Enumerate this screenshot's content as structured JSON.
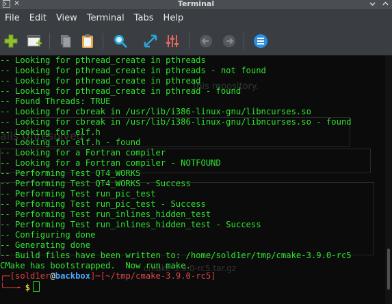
{
  "window": {
    "title": "Terminal",
    "left_icons": [
      "terminal-icon",
      "close-small-icon"
    ],
    "right_icons": [
      "minimize-icon",
      "maximize-icon"
    ]
  },
  "menu": [
    "File",
    "Edit",
    "View",
    "Terminal",
    "Tabs",
    "Help"
  ],
  "toolbar": {
    "icons": [
      "new-tab-icon",
      "new-window-icon",
      "copy-icon",
      "paste-icon",
      "search-icon",
      "fullscreen-icon",
      "settings-sliders-icon",
      "back-icon",
      "forward-icon",
      "menu-icon"
    ]
  },
  "terminal": {
    "lines": [
      "-- Looking for pthread_create in pthreads",
      "-- Looking for pthread_create in pthreads - not found",
      "-- Looking for pthread_create in pthread",
      "-- Looking for pthread_create in pthread - found",
      "-- Found Threads: TRUE",
      "-- Looking for cbreak in /usr/lib/i386-linux-gnu/libncurses.so",
      "-- Looking for cbreak in /usr/lib/i386-linux-gnu/libncurses.so - found",
      "-- Looking for elf.h",
      "-- Looking for elf.h - found",
      "-- Looking for a Fortran compiler",
      "-- Looking for a Fortran compiler - NOTFOUND",
      "-- Performing Test QT4_WORKS",
      "-- Performing Test QT4_WORKS - Success",
      "-- Performing Test run_pic_test",
      "-- Performing Test run_pic_test - Success",
      "-- Performing Test run_inlines_hidden_test",
      "-- Performing Test run_inlines_hidden_test - Success",
      "-- Configuring done",
      "-- Generating done",
      "-- Build files have been written to: /home/sold1er/tmp/cmake-3.9.0-rc5"
    ],
    "final_line": "CMake has bootstrapped.  Now run make.",
    "prompt": {
      "open": "┌─[",
      "user": "sold1er",
      "at": "@",
      "host": "backbox",
      "mid": "]─[",
      "path": "~/tmp/cmake-3.9.0-rc5",
      "close": "]",
      "line2": "└──╼ ",
      "dollar": "$"
    }
  },
  "background_ghost": {
    "repo_text": "this repository.",
    "resolved_text": "ails   Unresolved",
    "cmake_text": "cmake-3.9.0-rc5.tar.gz"
  },
  "colors": {
    "terminal_bg": "#0b0b0b",
    "text_green": "#2ee52e",
    "prompt_red": "#e23b3b",
    "host_blue": "#4aa8ff",
    "dollar_yellow": "#e8d33a"
  }
}
